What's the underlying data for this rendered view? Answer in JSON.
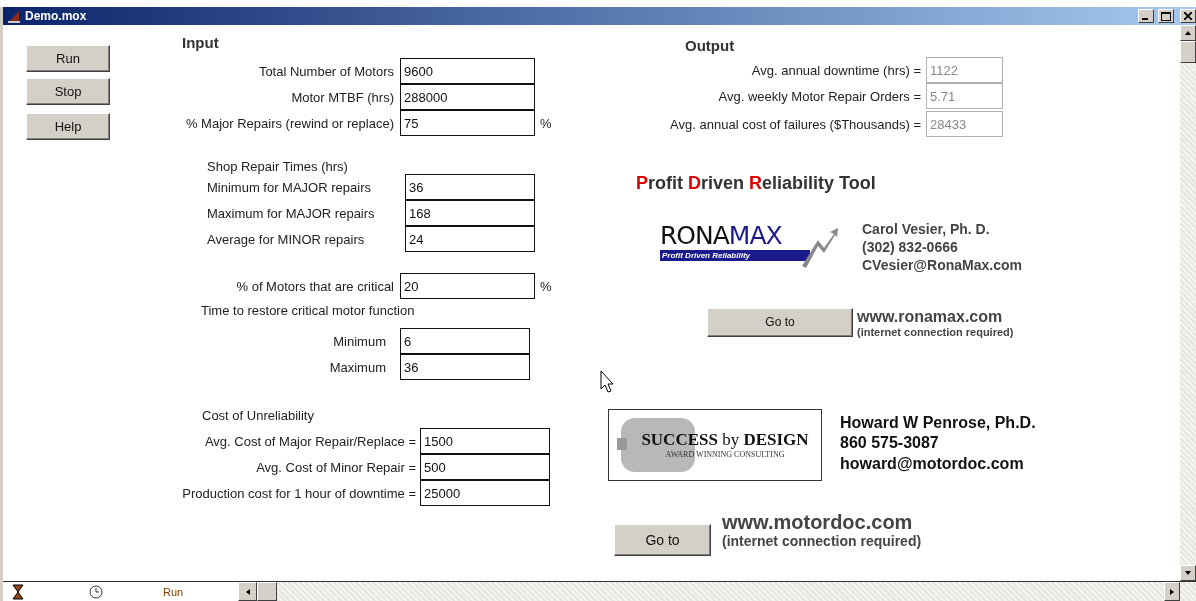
{
  "window": {
    "title": "Demo.mox"
  },
  "buttons": [
    "Run",
    "Stop",
    "Help"
  ],
  "input": {
    "heading": "Input",
    "groups": [
      {
        "fields": [
          {
            "label": "Total Number of Motors",
            "value": "9600"
          },
          {
            "label": "Motor MTBF (hrs)",
            "value": "288000"
          },
          {
            "label": "% Major Repairs (rewind or replace)",
            "value": "75",
            "unit": "%"
          }
        ]
      },
      {
        "title": "Shop Repair Times (hrs)",
        "fields": [
          {
            "label": "Minimum for MAJOR repairs",
            "value": "36"
          },
          {
            "label": "Maximum for MAJOR repairs",
            "value": "168"
          },
          {
            "label": "Average for MINOR repairs",
            "value": "24"
          }
        ]
      },
      {
        "fields": [
          {
            "label": "% of Motors that are critical",
            "value": "20",
            "unit": "%"
          }
        ]
      },
      {
        "title": "Time to restore critical motor function",
        "fields": [
          {
            "label": "Minimum",
            "value": "6"
          },
          {
            "label": "Maximum",
            "value": "36"
          }
        ]
      },
      {
        "title": "Cost of Unreliability",
        "fields": [
          {
            "label": "Avg. Cost of Major Repair/Replace =",
            "value": "1500"
          },
          {
            "label": "Avg. Cost of Minor Repair =",
            "value": "500"
          },
          {
            "label": "Production cost for 1 hour of downtime =",
            "value": "25000"
          }
        ]
      }
    ]
  },
  "output": {
    "heading": "Output",
    "fields": [
      {
        "label": "Avg. annual downtime (hrs) =",
        "value": "1122",
        "disabled": true
      },
      {
        "label": "Avg. weekly Motor Repair Orders =",
        "value": "5.71",
        "disabled": true
      },
      {
        "label": "Avg. annual cost of failures ($Thousands) =",
        "value": "28433",
        "disabled": true
      }
    ]
  },
  "tool_title": [
    {
      "text": "P",
      "accent": true
    },
    {
      "text": "rofit ",
      "accent": false
    },
    {
      "text": "D",
      "accent": true
    },
    {
      "text": "riven ",
      "accent": false
    },
    {
      "text": "R",
      "accent": true
    },
    {
      "text": "eliability Tool",
      "accent": false
    }
  ],
  "contacts": [
    {
      "kind": "ronamax",
      "logo": {
        "wordmark_1": "RONA",
        "wordmark_2": "MAX",
        "tagline": "Profit Driven Reliability"
      },
      "lines": [
        "Carol Vesier, Ph. D.",
        "(302) 832-0666",
        "CVesier@RonaMax.com"
      ],
      "button": "Go to",
      "url": "www.ronamax.com",
      "note": "(internet connection required)"
    },
    {
      "kind": "success",
      "logo": {
        "wordmark": "**SUCCESS** by **DESIGN**",
        "tagline": "AWARD WINNING CONSULTING"
      },
      "lines": [
        "Howard W Penrose, Ph.D.",
        "860 575-3087",
        "howard@motordoc.com"
      ],
      "button": "Go to",
      "url": "www.motordoc.com",
      "note": "(internet connection required)"
    }
  ],
  "status_bar": {
    "mode": "Run"
  }
}
